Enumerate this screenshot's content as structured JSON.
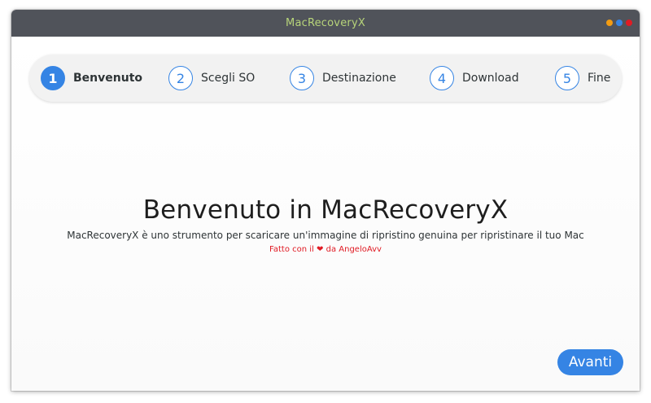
{
  "window": {
    "title": "MacRecoveryX"
  },
  "steps": [
    {
      "number": "1",
      "label": "Benvenuto",
      "active": true
    },
    {
      "number": "2",
      "label": "Scegli SO",
      "active": false
    },
    {
      "number": "3",
      "label": "Destinazione",
      "active": false
    },
    {
      "number": "4",
      "label": "Download",
      "active": false
    },
    {
      "number": "5",
      "label": "Fine",
      "active": false
    }
  ],
  "welcome": {
    "title": "Benvenuto in MacRecoveryX",
    "subtitle": "MacRecoveryX è uno strumento per scaricare un'immagine di ripristino genuina per ripristinare il tuo Mac",
    "credit_prefix": "Fatto con il",
    "credit_heart": "❤",
    "credit_suffix": "da AngeloAvv"
  },
  "actions": {
    "next_label": "Avanti"
  },
  "colors": {
    "accent": "#3584e4",
    "titlebar": "#50535a",
    "title_text": "#b7d47a",
    "credit_text": "#e01b24"
  }
}
